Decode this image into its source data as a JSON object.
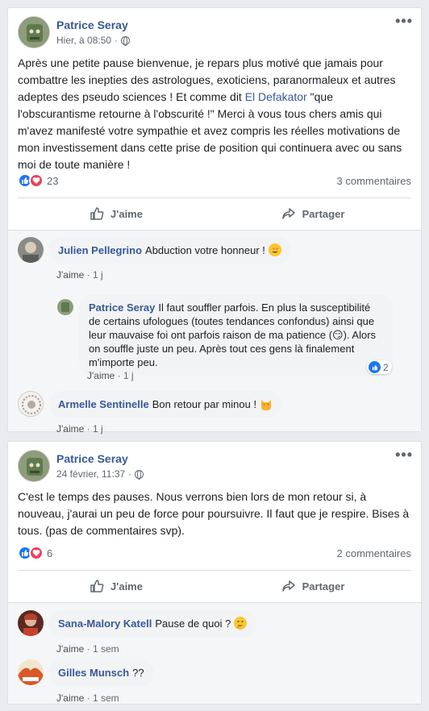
{
  "posts": [
    {
      "author": "Patrice Seray",
      "time": "Hier, à 08:50",
      "more": "•••",
      "text_before_link": "Après une petite pause bienvenue, je repars plus motivé que jamais pour combattre les inepties des astrologues, exoticiens, paranormaleux et autres adeptes des pseudo sciences ! Et comme dit ",
      "link": "El Defakator",
      "text_after_link": " \"que l'obscurantisme retourne à l'obscurité !\" Merci à vous tous chers amis qui m'avez manifesté votre sympathie et avez compris les réelles motivations de mon investissement dans cette prise de position qui continuera avec ou sans moi de toute manière !",
      "reaction_count": "23",
      "comments_count": "3 commentaires",
      "like_label": "J'aime",
      "share_label": "Partager",
      "comments": [
        {
          "name": "Julien Pellegrino",
          "text": "Abduction votre honneur !",
          "emoji": "heart-eyes-emoji",
          "like": "J'aime",
          "age": "1 j"
        },
        {
          "name": "Patrice Seray",
          "text": "Il faut souffler parfois. En plus la susceptibilité de certains ufologues (toutes tendances confondus) ainsi que leur mauvaise foi ont parfois raison de ma patience (😏). Alors on souffle juste un peu. Après tout ces gens là finalement m'importe peu.",
          "like": "J'aime",
          "age": "1 j",
          "reactions": "2"
        },
        {
          "name": "Armelle Sentinelle",
          "text": "Bon retour par minou !",
          "emoji": "cat-heart-eyes-emoji",
          "like": "J'aime",
          "age": "1 j"
        }
      ]
    },
    {
      "author": "Patrice Seray",
      "time": "24 février, 11:37",
      "more": "•••",
      "text": "C'est le temps des pauses. Nous verrons bien lors de mon retour si, à nouveau, j'aurai un peu de force pour poursuivre. Il faut que je respire. Bises à tous. (pas de commentaires svp).",
      "reaction_count": "6",
      "comments_count": "2 commentaires",
      "like_label": "J'aime",
      "share_label": "Partager",
      "comments": [
        {
          "name": "Sana-Malory Katell",
          "text": "Pause de quoi ?",
          "emoji": "thinking-emoji",
          "like": "J'aime",
          "age": "1 sem"
        },
        {
          "name": "Gilles Munsch",
          "text": "??",
          "like": "J'aime",
          "age": "1 sem"
        }
      ]
    }
  ],
  "colors": {
    "link": "#385898",
    "like": "#1877f2",
    "love": "#f33e58",
    "background": "#e9ebee"
  }
}
